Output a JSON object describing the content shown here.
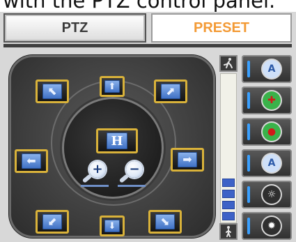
{
  "caption": "with the PTZ control panel.",
  "tabs": {
    "ptz_label": "PTZ",
    "preset_label": "PRESET",
    "active": "PTZ",
    "preset_color": "#f39a35"
  },
  "joystick": {
    "direction_buttons": [
      {
        "name": "pan-up-left-button",
        "icon": "arrow-up-left-icon",
        "glyph": "⬉"
      },
      {
        "name": "pan-up-button",
        "icon": "arrow-up-icon",
        "glyph": "⬆"
      },
      {
        "name": "pan-up-right-button",
        "icon": "arrow-up-right-icon",
        "glyph": "⬈"
      },
      {
        "name": "pan-left-button",
        "icon": "arrow-left-icon",
        "glyph": "⬅"
      },
      {
        "name": "pan-right-button",
        "icon": "arrow-right-icon",
        "glyph": "➡"
      },
      {
        "name": "pan-down-left-button",
        "icon": "arrow-down-left-icon",
        "glyph": "⬋"
      },
      {
        "name": "pan-down-button",
        "icon": "arrow-down-icon",
        "glyph": "⬇"
      },
      {
        "name": "pan-down-right-button",
        "icon": "arrow-down-right-icon",
        "glyph": "⬊"
      }
    ],
    "home_label": "H",
    "zoom_in_glyph": "+",
    "zoom_out_glyph": "−",
    "button_border_color": "#d9b23a",
    "icon_color": "#5b8ad6"
  },
  "speed_slider": {
    "top_icon": "running-person-icon",
    "bottom_icon": "walking-person-icon",
    "level_fraction": 0.33
  },
  "right_controls": [
    {
      "name": "iris-auto-button",
      "icon": "auto-iris-icon",
      "glyph": "A",
      "icon_bg": "#cfe0f8",
      "glyph_color": "#2c5aa8"
    },
    {
      "name": "focus-near-button",
      "icon": "focus-red-icon",
      "glyph": "✚",
      "icon_bg": "#3ab24a",
      "glyph_color": "#d11a1a"
    },
    {
      "name": "focus-far-button",
      "icon": "focus-green-icon",
      "glyph": "●",
      "icon_bg": "#3ab24a",
      "glyph_color": "#d11a1a"
    },
    {
      "name": "auto-brightness-button",
      "icon": "auto-brightness-icon",
      "glyph": "A",
      "icon_bg": "#cfe0f8",
      "glyph_color": "#2c5aa8"
    },
    {
      "name": "brightness-low-button",
      "icon": "sun-outline-icon",
      "glyph": "☼",
      "icon_bg": "#2f2f2f",
      "glyph_color": "#ffffff"
    },
    {
      "name": "brightness-high-button",
      "icon": "sun-filled-icon",
      "glyph": "✹",
      "icon_bg": "#2f2f2f",
      "glyph_color": "#ffffff"
    }
  ]
}
